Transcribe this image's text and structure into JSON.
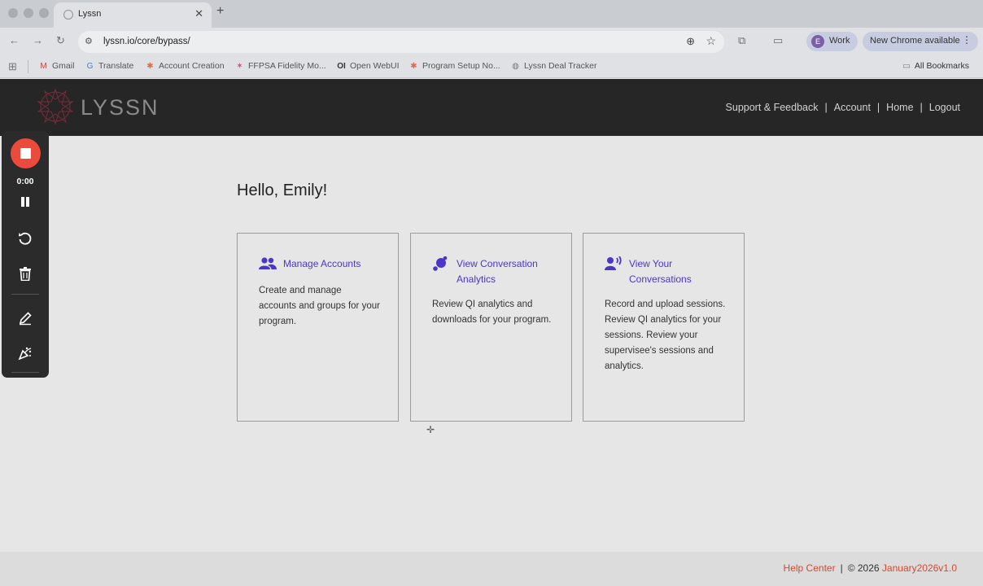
{
  "browser": {
    "tab_title": "Lyssn",
    "tab_close": "✕",
    "new_tab": "+",
    "url": "lyssn.io/core/bypass/",
    "profile_initial": "E",
    "profile_label": "Work",
    "update_label": "New Chrome available",
    "bookmarks": [
      {
        "label": "Gmail",
        "icon": "gmail-icon"
      },
      {
        "label": "Translate",
        "icon": "translate-icon"
      },
      {
        "label": "Account Creation",
        "icon": "hubspot-icon"
      },
      {
        "label": "FFPSA Fidelity Mo...",
        "icon": "pinwheel-icon"
      },
      {
        "label": "Open WebUI",
        "icon": "openwebui-icon"
      },
      {
        "label": "Program Setup No...",
        "icon": "hubspot-icon"
      },
      {
        "label": "Lyssn Deal Tracker",
        "icon": "globe-icon"
      }
    ],
    "all_bookmarks": "All Bookmarks"
  },
  "site": {
    "logo_text": "LYSSN",
    "nav": {
      "support": "Support & Feedback",
      "account": "Account",
      "home": "Home",
      "logout": "Logout",
      "separator": "|"
    }
  },
  "main": {
    "greeting": "Hello, Emily!",
    "cards": [
      {
        "icon": "users-icon",
        "title": "Manage Accounts",
        "description": "Create and manage accounts and groups for your program."
      },
      {
        "icon": "analytics-dots-icon",
        "title": "View Conversation Analytics",
        "description": "Review QI analytics and downloads for your program."
      },
      {
        "icon": "speaking-person-icon",
        "title": "View Your Conversations",
        "description": "Record and upload sessions. Review QI analytics for your sessions. Review your supervisee's sessions and analytics."
      }
    ]
  },
  "footer": {
    "help": "Help Center",
    "separator": "|",
    "copyright": "© 2026",
    "version": "January2026v1.0"
  },
  "recorder": {
    "time": "0:00"
  },
  "colors": {
    "header_bg": "#262626",
    "card_link": "#4a36c8",
    "footer_link": "#d24a30",
    "record_red": "#ea4b3c",
    "page_bg": "#e6e6e6"
  }
}
